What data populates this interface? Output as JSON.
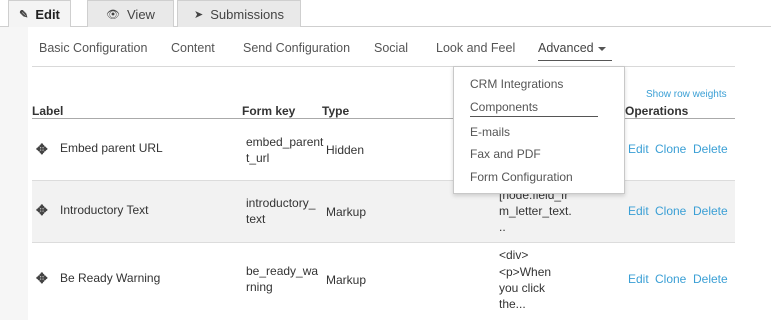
{
  "top_tabs": [
    {
      "label": "Edit",
      "icon": "pencil-icon"
    },
    {
      "label": "View",
      "icon": "eye-icon"
    },
    {
      "label": "Submissions",
      "icon": "paper-plane-icon"
    }
  ],
  "sub_tabs": [
    "Basic Configuration",
    "Content",
    "Send Configuration",
    "Social",
    "Look and Feel",
    "Advanced"
  ],
  "show_row_weights": "Show row weights",
  "table": {
    "headers": {
      "label": "Label",
      "form_key": "Form key",
      "type": "Type",
      "operations": "Operations"
    },
    "rows": [
      {
        "label": "Embed parent URL",
        "key_line1": "embed_parent",
        "key_line2": "t_url",
        "type": "Hidden",
        "value_lines": [],
        "ops": [
          "Edit",
          "Clone",
          "Delete"
        ]
      },
      {
        "label": "Introductory Text",
        "key_line1": "introductory_",
        "key_line2": "text",
        "type": "Markup",
        "value_lines": [
          "[node:field_fr",
          "m_letter_text.",
          ".."
        ],
        "ops": [
          "Edit",
          "Clone",
          "Delete"
        ]
      },
      {
        "label": "Be Ready Warning",
        "key_line1": "be_ready_wa",
        "key_line2": "rning",
        "type": "Markup",
        "value_lines": [
          "<div>",
          "<p>When",
          "you click",
          "the..."
        ],
        "ops": [
          "Edit",
          "Clone",
          "Delete"
        ]
      }
    ]
  },
  "dropdown": {
    "items": [
      "CRM Integrations",
      "Components",
      "E-mails",
      "Fax and PDF",
      "Form Configuration"
    ]
  },
  "colors": {
    "link": "#3a9fd5",
    "alt_row": "#f2f2f2"
  }
}
